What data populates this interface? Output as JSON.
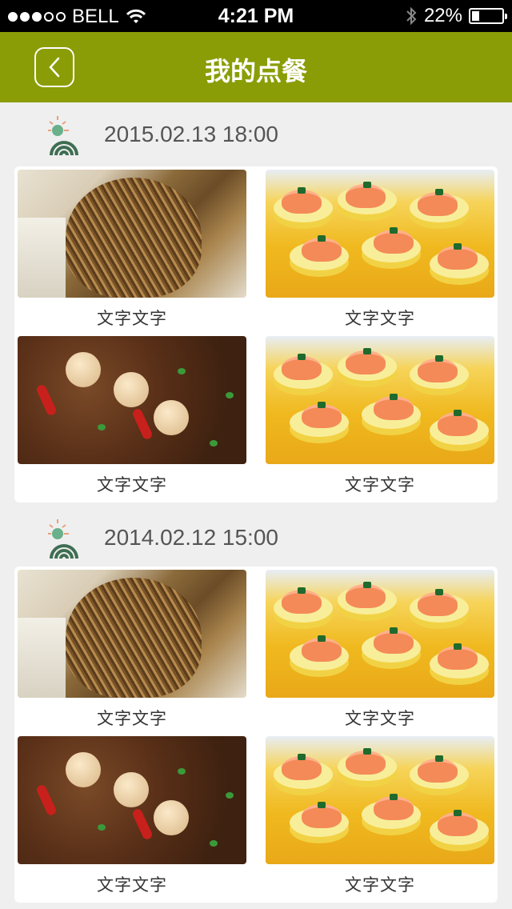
{
  "status_bar": {
    "carrier": "BELL",
    "time": "4:21 PM",
    "battery": "22%",
    "battery_level": 0.22,
    "signal_bars": 3,
    "icons": [
      "wifi-icon",
      "bluetooth-icon",
      "battery-icon"
    ]
  },
  "nav": {
    "title": "我的点餐",
    "back_icon": "chevron-left-icon",
    "color": "#8a9d07"
  },
  "sections": [
    {
      "date": "2015.02.13 18:00",
      "items": [
        {
          "caption": "文字文字",
          "image": "fried-noodles"
        },
        {
          "caption": "文字文字",
          "image": "shrimp-egg-tofu"
        },
        {
          "caption": "文字文字",
          "image": "braised-stew"
        },
        {
          "caption": "文字文字",
          "image": "shrimp-egg-tofu"
        }
      ]
    },
    {
      "date": "2014.02.12 15:00",
      "items": [
        {
          "caption": "文字文字",
          "image": "fried-noodles"
        },
        {
          "caption": "文字文字",
          "image": "shrimp-egg-tofu"
        },
        {
          "caption": "文字文字",
          "image": "braised-stew"
        },
        {
          "caption": "文字文字",
          "image": "shrimp-egg-tofu"
        }
      ]
    }
  ]
}
